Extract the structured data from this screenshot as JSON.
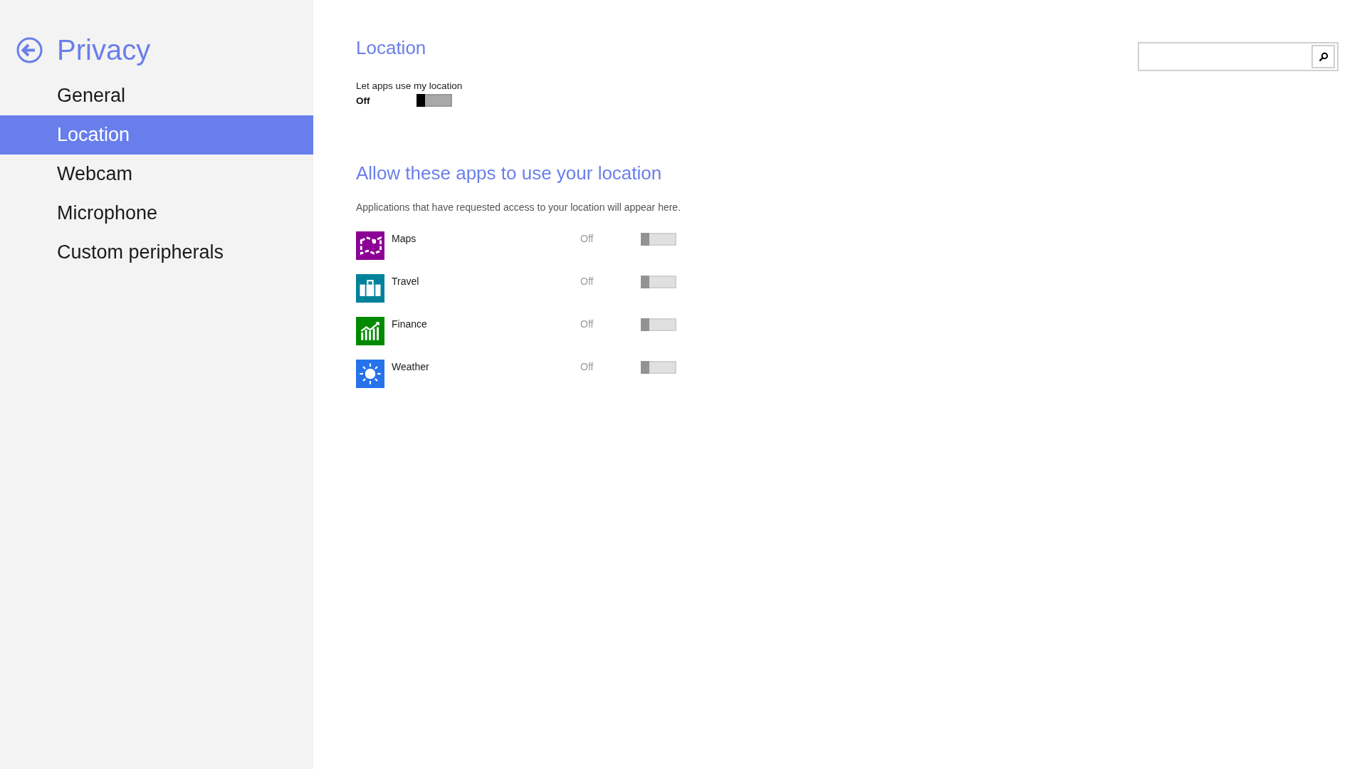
{
  "sidebar": {
    "title": "Privacy",
    "items": [
      {
        "label": "General",
        "selected": false
      },
      {
        "label": "Location",
        "selected": true
      },
      {
        "label": "Webcam",
        "selected": false
      },
      {
        "label": "Microphone",
        "selected": false
      },
      {
        "label": "Custom peripherals",
        "selected": false
      }
    ]
  },
  "main": {
    "title": "Location",
    "master": {
      "label": "Let apps use my location",
      "state_text": "Off",
      "on": false
    },
    "section_title": "Allow these apps to use your location",
    "description": "Applications that have requested access to your location will appear here.",
    "apps": [
      {
        "name": "Maps",
        "color": "#8c0095",
        "state_text": "Off",
        "on": false,
        "disabled": true
      },
      {
        "name": "Travel",
        "color": "#00829b",
        "state_text": "Off",
        "on": false,
        "disabled": true
      },
      {
        "name": "Finance",
        "color": "#008a00",
        "state_text": "Off",
        "on": false,
        "disabled": true
      },
      {
        "name": "Weather",
        "color": "#2673ec",
        "state_text": "Off",
        "on": false,
        "disabled": true
      }
    ]
  }
}
